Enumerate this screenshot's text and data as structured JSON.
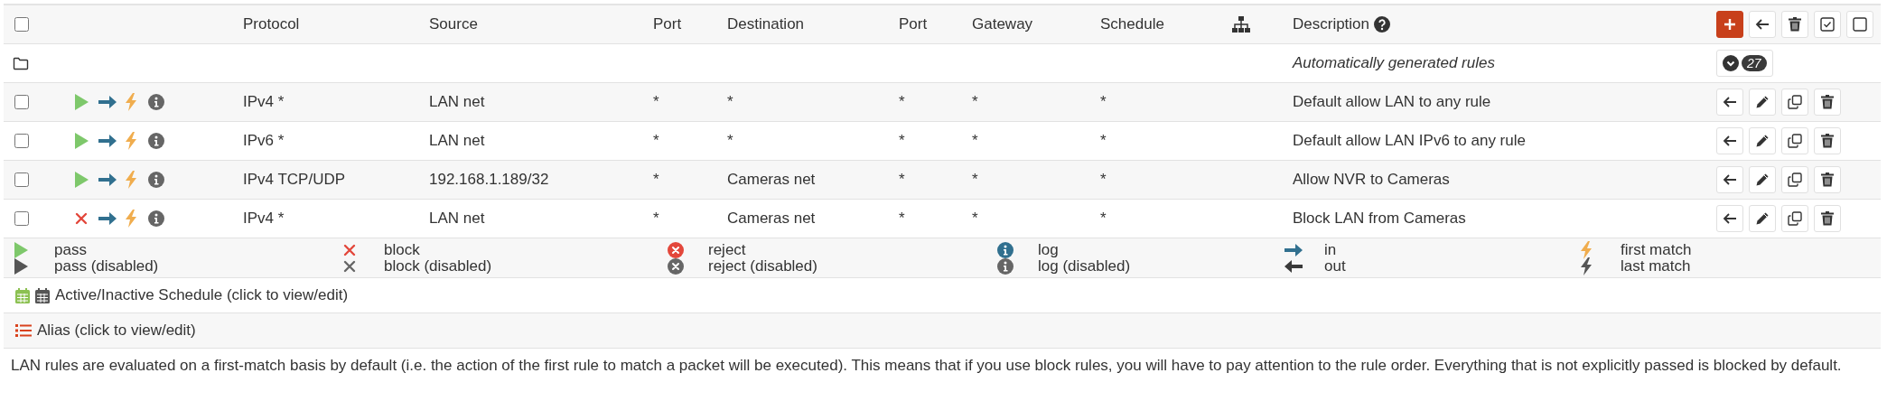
{
  "table": {
    "select_all": {
      "checked": false
    },
    "columns": [
      {
        "label": "Protocol",
        "help": false
      },
      {
        "label": "Source",
        "help": false
      },
      {
        "label": "Port",
        "help": false
      },
      {
        "label": "Destination",
        "help": false
      },
      {
        "label": "Port",
        "help": false
      },
      {
        "label": "Gateway",
        "help": false
      },
      {
        "label": "Schedule",
        "help": false
      },
      {
        "label": "Description",
        "help": true
      }
    ],
    "header_actions": [
      {
        "kind": "add"
      },
      {
        "kind": "move"
      },
      {
        "kind": "delete"
      },
      {
        "kind": "select"
      },
      {
        "kind": "deselect"
      }
    ],
    "group": {
      "label": "Automatically generated rules",
      "count": "27",
      "expanded": false
    },
    "row_actions": [
      {
        "kind": "move"
      },
      {
        "kind": "edit"
      },
      {
        "kind": "copy"
      },
      {
        "kind": "delete"
      }
    ],
    "rules": [
      {
        "checked": false,
        "icons": [
          {
            "kind": "pass",
            "disabled": false
          },
          {
            "kind": "in",
            "disabled": false
          },
          {
            "kind": "first",
            "disabled": false
          },
          {
            "kind": "log",
            "disabled": true
          }
        ],
        "protocol": "IPv4 *",
        "source": "LAN net",
        "source_port": "*",
        "destination": "*",
        "destination_port": "*",
        "gateway": "*",
        "schedule": "*",
        "description": "Default allow LAN to any rule"
      },
      {
        "checked": false,
        "icons": [
          {
            "kind": "pass",
            "disabled": false
          },
          {
            "kind": "in",
            "disabled": false
          },
          {
            "kind": "first",
            "disabled": false
          },
          {
            "kind": "log",
            "disabled": true
          }
        ],
        "protocol": "IPv6 *",
        "source": "LAN net",
        "source_port": "*",
        "destination": "*",
        "destination_port": "*",
        "gateway": "*",
        "schedule": "*",
        "description": "Default allow LAN IPv6 to any rule"
      },
      {
        "checked": false,
        "icons": [
          {
            "kind": "pass",
            "disabled": false
          },
          {
            "kind": "in",
            "disabled": false
          },
          {
            "kind": "first",
            "disabled": false
          },
          {
            "kind": "log",
            "disabled": true
          }
        ],
        "protocol": "IPv4 TCP/UDP",
        "source": "192.168.1.189/32",
        "source_port": "*",
        "destination": "Cameras net",
        "destination_port": "*",
        "gateway": "*",
        "schedule": "*",
        "description": "Allow NVR to Cameras"
      },
      {
        "checked": false,
        "icons": [
          {
            "kind": "block",
            "disabled": false
          },
          {
            "kind": "in",
            "disabled": false
          },
          {
            "kind": "first",
            "disabled": false
          },
          {
            "kind": "log",
            "disabled": true
          }
        ],
        "protocol": "IPv4 *",
        "source": "LAN net",
        "source_port": "*",
        "destination": "Cameras net",
        "destination_port": "*",
        "gateway": "*",
        "schedule": "*",
        "description": "Block LAN from Cameras"
      }
    ]
  },
  "legend": [
    {
      "kind": "pass",
      "disabled": false,
      "label": "pass"
    },
    {
      "kind": "block",
      "disabled": false,
      "label": "block"
    },
    {
      "kind": "reject",
      "disabled": false,
      "label": "reject"
    },
    {
      "kind": "log",
      "disabled": false,
      "label": "log"
    },
    {
      "kind": "in",
      "disabled": false,
      "label": "in"
    },
    {
      "kind": "first",
      "disabled": false,
      "label": "first match"
    },
    {
      "kind": "pass",
      "disabled": true,
      "label": "pass (disabled)"
    },
    {
      "kind": "block",
      "disabled": true,
      "label": "block (disabled)"
    },
    {
      "kind": "reject",
      "disabled": true,
      "label": "reject (disabled)"
    },
    {
      "kind": "log",
      "disabled": true,
      "label": "log (disabled)"
    },
    {
      "kind": "out",
      "disabled": false,
      "label": "out"
    },
    {
      "kind": "last",
      "disabled": false,
      "label": "last match"
    }
  ],
  "schedule_note": "Active/Inactive Schedule (click to view/edit)",
  "alias_note": "Alias (click to view/edit)",
  "footnote": "LAN rules are evaluated on a first-match basis by default (i.e. the action of the first rule to match a packet will be executed). This means that if you use block rules, you will have to pay attention to the rule order. Everything that is not explicitly passed is blocked by default."
}
